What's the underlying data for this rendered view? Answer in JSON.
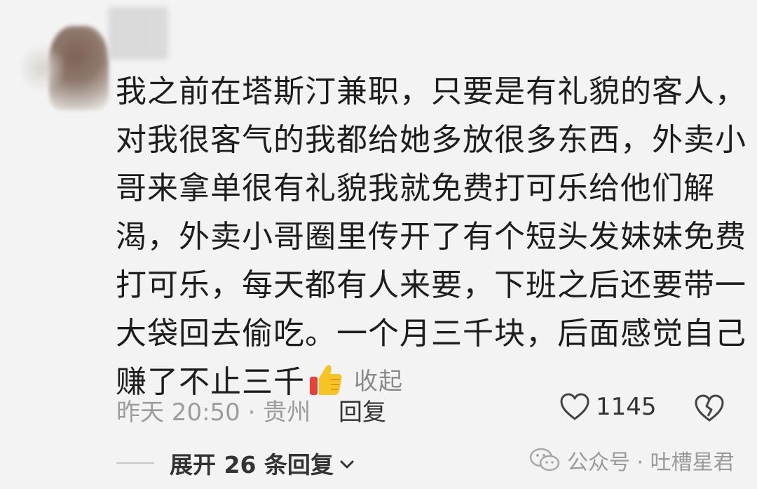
{
  "comment": {
    "lines": [
      "我之前在塔斯汀兼职，只要是有礼貌的客人，",
      "对我很客气的我都给她多放很多东西，外卖小",
      "哥来拿单很有礼貌我就免费打可乐给他们解",
      "渴，外卖小哥圈里传开了有个短头发妹妹免费",
      "打可乐，每天都有人来要，下班之后还要带一",
      "大袋回去偷吃。一个月三千块，后面感觉自己",
      "赚了不止三千"
    ],
    "collapse_label": "收起"
  },
  "meta": {
    "time_location": "昨天 20:50 · 贵州",
    "reply_label": "回复",
    "like_count": "1145"
  },
  "replies": {
    "expand_label": "展开 26 条回复"
  },
  "watermark": {
    "text": "公众号 · 吐槽星君"
  },
  "icons": {
    "thumb": "thumbs-up-emoji",
    "like": "heart-outline-icon",
    "dislike": "broken-heart-icon",
    "expand": "chevron-down-icon",
    "watermark": "wechat-icon"
  }
}
